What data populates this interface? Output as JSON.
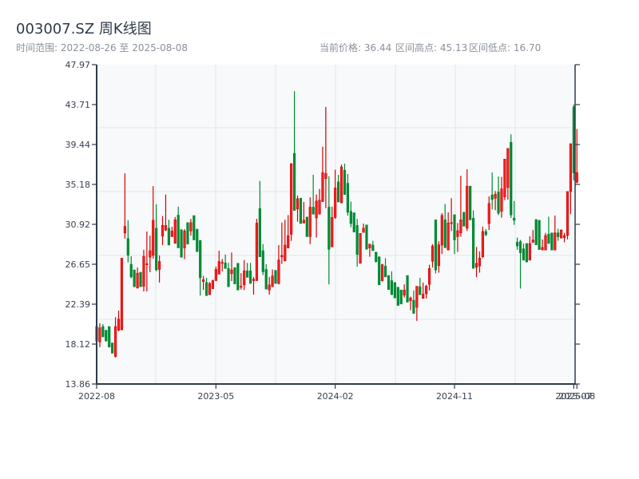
{
  "header": {
    "title": "003007.SZ 周K线图",
    "range_label": "时间范围: 2022-08-26 至 2025-08-08",
    "current_price_label": "当前价格: 36.44",
    "high_label": "区间高点: 45.13",
    "low_label": "区间低点: 16.70"
  },
  "colors": {
    "up": "#d60000",
    "up_fill": "#f02020",
    "down": "#008a32",
    "plot_bg": "#f7f9fb",
    "grid": "#e3e6ea",
    "axis": "#2f3b4c"
  },
  "chart_data": {
    "type": "candlestick",
    "title": "003007.SZ 周K线图",
    "frequency": "weekly",
    "date_range": [
      "2022-08-26",
      "2025-08-08"
    ],
    "ylim": [
      13.86,
      47.97
    ],
    "y_ticks": [
      "47.97",
      "43.71",
      "39.44",
      "35.18",
      "30.92",
      "26.65",
      "22.39",
      "18.12",
      "13.86"
    ],
    "x_ticks": [
      {
        "index": 0,
        "label": "2022-08"
      },
      {
        "index": 38,
        "label": "2023-05"
      },
      {
        "index": 76,
        "label": "2024-02"
      },
      {
        "index": 114,
        "label": "2024-11"
      },
      {
        "index": 152,
        "label": "2025-07"
      },
      {
        "index": 153,
        "label": "2025-08"
      }
    ],
    "grid": true,
    "up_color": "red",
    "down_color": "green",
    "ohlc_fields": [
      "open",
      "high",
      "low",
      "close"
    ],
    "candles": [
      [
        20.0,
        20.0,
        18.45,
        18.45
      ],
      [
        18.35,
        20.35,
        17.8,
        19.85
      ],
      [
        20.0,
        20.25,
        18.85,
        18.9
      ],
      [
        19.6,
        19.6,
        18.4,
        18.45
      ],
      [
        20.0,
        20.0,
        17.8,
        17.8
      ],
      [
        18.25,
        18.25,
        17.15,
        17.15
      ],
      [
        16.8,
        21.0,
        16.7,
        20.0
      ],
      [
        19.6,
        21.7,
        19.5,
        20.8
      ],
      [
        19.65,
        27.3,
        19.6,
        27.3
      ],
      [
        30.0,
        36.35,
        29.4,
        30.7
      ],
      [
        29.4,
        31.35,
        26.85,
        27.6
      ],
      [
        26.65,
        27.5,
        25.15,
        25.3
      ],
      [
        26.05,
        26.05,
        24.25,
        24.25
      ],
      [
        24.1,
        26.3,
        24.1,
        25.7
      ],
      [
        25.8,
        25.8,
        24.25,
        24.25
      ],
      [
        24.3,
        28.2,
        23.75,
        27.5
      ],
      [
        26.6,
        30.15,
        23.75,
        26.7
      ],
      [
        27.4,
        29.7,
        25.8,
        28.1
      ],
      [
        27.6,
        35.0,
        27.25,
        31.35
      ],
      [
        30.5,
        33.05,
        25.9,
        26.05
      ],
      [
        26.1,
        27.6,
        24.7,
        26.95
      ],
      [
        29.65,
        31.8,
        28.7,
        30.8
      ],
      [
        30.3,
        34.1,
        30.2,
        30.8
      ],
      [
        30.5,
        31.4,
        28.7,
        28.7
      ],
      [
        29.6,
        30.65,
        29.6,
        30.2
      ],
      [
        28.9,
        31.7,
        28.85,
        31.4
      ],
      [
        31.9,
        32.8,
        28.4,
        28.4
      ],
      [
        30.35,
        30.35,
        27.4,
        27.4
      ],
      [
        28.4,
        30.4,
        27.2,
        30.2
      ],
      [
        31.1,
        31.1,
        28.8,
        28.8
      ],
      [
        30.2,
        31.5,
        29.7,
        31.1
      ],
      [
        31.85,
        31.85,
        29.25,
        29.25
      ],
      [
        30.4,
        30.4,
        28.0,
        28.0
      ],
      [
        29.2,
        29.2,
        23.3,
        25.2
      ],
      [
        24.8,
        25.4,
        23.9,
        25.0
      ],
      [
        24.7,
        25.2,
        23.3,
        23.3
      ],
      [
        23.4,
        24.75,
        23.4,
        24.6
      ],
      [
        24.05,
        25.0,
        24.0,
        24.9
      ],
      [
        24.9,
        26.4,
        24.9,
        26.1
      ],
      [
        25.6,
        28.1,
        25.6,
        26.95
      ],
      [
        26.75,
        27.2,
        25.9,
        26.85
      ],
      [
        26.8,
        27.7,
        26.2,
        26.2
      ],
      [
        26.2,
        26.8,
        24.25,
        24.25
      ],
      [
        25.65,
        27.9,
        24.85,
        26.05
      ],
      [
        26.3,
        26.3,
        24.55,
        24.55
      ],
      [
        26.75,
        26.75,
        23.9,
        23.9
      ],
      [
        24.2,
        25.7,
        23.95,
        24.3
      ],
      [
        24.45,
        27.1,
        23.9,
        25.95
      ],
      [
        25.95,
        26.8,
        25.25,
        25.25
      ],
      [
        25.95,
        26.8,
        24.6,
        24.6
      ],
      [
        24.9,
        25.3,
        23.4,
        25.05
      ],
      [
        24.9,
        31.5,
        24.9,
        31.05
      ],
      [
        32.6,
        35.55,
        27.45,
        27.45
      ],
      [
        28.1,
        28.8,
        25.5,
        25.85
      ],
      [
        26.1,
        26.65,
        24.0,
        24.0
      ],
      [
        23.9,
        25.3,
        23.4,
        24.45
      ],
      [
        24.25,
        26.1,
        24.25,
        25.4
      ],
      [
        26.0,
        26.0,
        24.6,
        24.6
      ],
      [
        24.6,
        28.7,
        24.5,
        27.1
      ],
      [
        27.45,
        31.1,
        26.7,
        27.6
      ],
      [
        27.0,
        31.4,
        27.0,
        28.7
      ],
      [
        28.4,
        31.9,
        28.35,
        29.7
      ],
      [
        29.85,
        37.4,
        29.15,
        37.4
      ],
      [
        38.5,
        45.13,
        32.4,
        32.4
      ],
      [
        32.55,
        34.0,
        31.2,
        33.65
      ],
      [
        33.7,
        33.7,
        31.0,
        31.0
      ],
      [
        31.05,
        33.3,
        31.05,
        31.35
      ],
      [
        31.7,
        31.7,
        29.6,
        29.6
      ],
      [
        29.6,
        33.8,
        28.8,
        32.75
      ],
      [
        32.75,
        36.2,
        32.0,
        32.0
      ],
      [
        31.6,
        34.1,
        29.5,
        33.4
      ],
      [
        32.0,
        34.7,
        32.0,
        33.5
      ],
      [
        33.35,
        39.2,
        33.3,
        36.45
      ],
      [
        35.8,
        43.45,
        32.65,
        36.35
      ],
      [
        32.75,
        36.05,
        24.5,
        28.25
      ],
      [
        28.5,
        32.8,
        28.5,
        31.65
      ],
      [
        31.65,
        36.75,
        31.5,
        34.8
      ],
      [
        35.45,
        36.2,
        33.3,
        33.3
      ],
      [
        33.2,
        37.3,
        33.2,
        37.05
      ],
      [
        36.7,
        37.4,
        34.1,
        34.1
      ],
      [
        35.3,
        36.3,
        31.85,
        32.2
      ],
      [
        32.3,
        33.35,
        30.6,
        31.0
      ],
      [
        32.15,
        32.15,
        30.1,
        30.1
      ],
      [
        30.8,
        31.5,
        26.4,
        27.7
      ],
      [
        26.75,
        29.95,
        26.75,
        29.95
      ],
      [
        30.05,
        31.0,
        30.05,
        30.5
      ],
      [
        30.85,
        30.85,
        28.25,
        28.25
      ],
      [
        28.4,
        28.8,
        27.45,
        28.8
      ],
      [
        28.7,
        29.15,
        28.1,
        28.1
      ],
      [
        27.95,
        27.95,
        26.9,
        26.9
      ],
      [
        27.45,
        27.45,
        24.45,
        24.45
      ],
      [
        24.9,
        26.7,
        24.8,
        26.6
      ],
      [
        26.45,
        27.3,
        25.3,
        25.3
      ],
      [
        25.45,
        25.45,
        23.95,
        23.95
      ],
      [
        24.9,
        25.9,
        23.4,
        23.4
      ],
      [
        24.7,
        24.7,
        23.05,
        23.05
      ],
      [
        24.2,
        24.2,
        22.25,
        22.25
      ],
      [
        23.9,
        23.9,
        22.4,
        22.4
      ],
      [
        23.35,
        24.5,
        23.1,
        23.9
      ],
      [
        25.45,
        25.45,
        22.6,
        22.6
      ],
      [
        22.75,
        23.2,
        21.75,
        23.05
      ],
      [
        22.8,
        23.85,
        21.4,
        21.4
      ],
      [
        22.05,
        24.3,
        20.6,
        24.3
      ],
      [
        24.25,
        25.2,
        23.4,
        23.4
      ],
      [
        23.0,
        24.7,
        23.0,
        23.45
      ],
      [
        23.5,
        24.45,
        23.0,
        24.3
      ],
      [
        24.5,
        26.6,
        23.85,
        26.2
      ],
      [
        26.97,
        28.8,
        26.3,
        28.6
      ],
      [
        31.4,
        31.4,
        25.67,
        26.04
      ],
      [
        26.5,
        29.1,
        25.75,
        28.73
      ],
      [
        28.7,
        32.1,
        27.74,
        31.86
      ],
      [
        31.4,
        33.1,
        28.36,
        28.45
      ],
      [
        28.17,
        32.2,
        28.17,
        31.06
      ],
      [
        31.0,
        33.7,
        30.2,
        31.1
      ],
      [
        31.95,
        31.95,
        27.74,
        29.25
      ],
      [
        29.6,
        31.06,
        27.97,
        30.24
      ],
      [
        30.0,
        36.1,
        29.6,
        31.4
      ],
      [
        32.2,
        32.2,
        30.72,
        30.72
      ],
      [
        30.5,
        36.8,
        30.2,
        34.99
      ],
      [
        34.99,
        34.99,
        31.35,
        31.4
      ],
      [
        31.57,
        32.4,
        26.17,
        26.23
      ],
      [
        26.32,
        28.5,
        25.27,
        26.75
      ],
      [
        26.46,
        28.02,
        25.75,
        27.31
      ],
      [
        27.45,
        30.67,
        27.31,
        30.15
      ],
      [
        30.15,
        30.4,
        29.67,
        29.8
      ],
      [
        31.0,
        33.9,
        30.3,
        33.14
      ],
      [
        34.05,
        36.46,
        32.5,
        33.56
      ],
      [
        33.7,
        34.47,
        32.43,
        34.13
      ],
      [
        34.36,
        36.03,
        31.9,
        32.1
      ],
      [
        32.3,
        35.98,
        31.63,
        34.7
      ],
      [
        33.85,
        37.88,
        33.5,
        37.88
      ],
      [
        34.84,
        39.02,
        33.56,
        39.02
      ],
      [
        39.67,
        40.53,
        31.6,
        31.92
      ],
      [
        31.57,
        33.4,
        30.86,
        31.35
      ],
      [
        29.0,
        29.5,
        28.2,
        28.6
      ],
      [
        29.07,
        29.25,
        24.05,
        27.88
      ],
      [
        28.3,
        28.87,
        27.09,
        27.09
      ],
      [
        28.87,
        28.87,
        26.89,
        26.89
      ],
      [
        27.09,
        29.64,
        27.09,
        28.87
      ],
      [
        29.0,
        30.3,
        28.93,
        29.24
      ],
      [
        31.43,
        31.43,
        28.73,
        28.73
      ],
      [
        31.35,
        31.35,
        28.22,
        28.22
      ],
      [
        28.22,
        29.3,
        28.1,
        28.45
      ],
      [
        28.17,
        30.0,
        28.17,
        29.73
      ],
      [
        29.87,
        31.72,
        28.87,
        28.87
      ],
      [
        30.0,
        30.0,
        28.17,
        28.17
      ],
      [
        28.17,
        31.86,
        28.17,
        30.0
      ],
      [
        30.0,
        30.44,
        29.16,
        29.59
      ],
      [
        29.44,
        30.38,
        29.44,
        30.3
      ],
      [
        29.5,
        30.0,
        29.0,
        29.7
      ],
      [
        29.73,
        34.42,
        29.3,
        34.42
      ],
      [
        34.42,
        39.53,
        32.0,
        39.53
      ],
      [
        43.45,
        43.7,
        35.6,
        36.4
      ],
      [
        35.4,
        41.1,
        35.3,
        36.44
      ]
    ]
  }
}
